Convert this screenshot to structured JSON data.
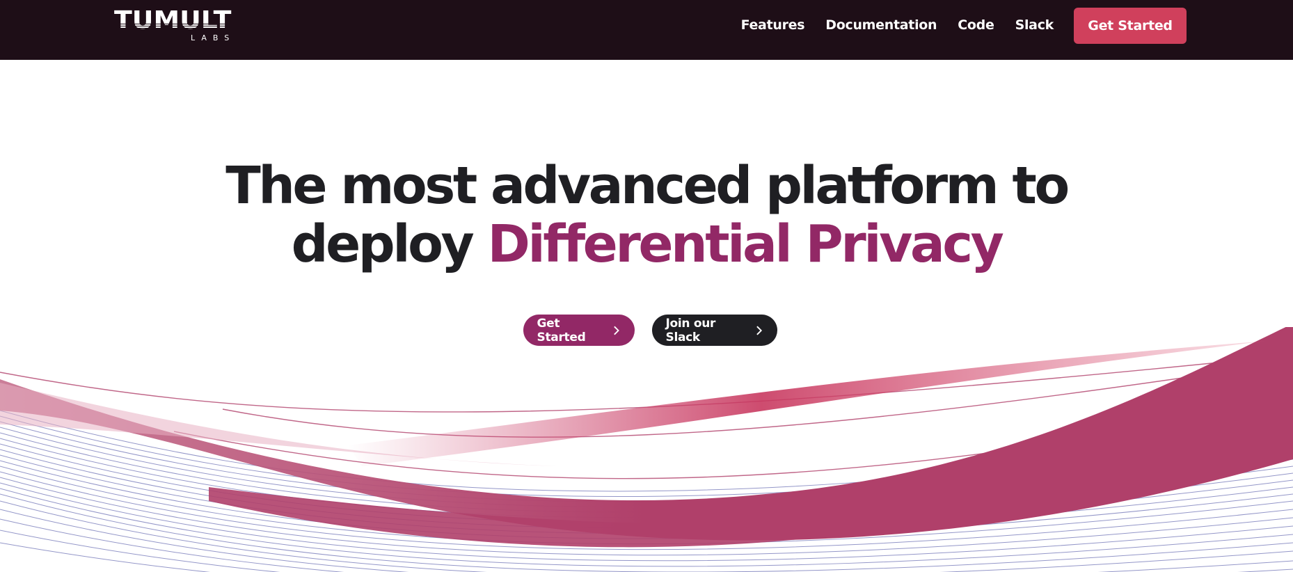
{
  "nav": {
    "logo_main": "TUMULT",
    "logo_sub": "LABS",
    "links": [
      {
        "label": "Features"
      },
      {
        "label": "Documentation"
      },
      {
        "label": "Code"
      },
      {
        "label": "Slack"
      }
    ],
    "cta_label": "Get Started"
  },
  "hero": {
    "title_line1": "The most advanced platform to",
    "title_line2_prefix": "deploy ",
    "title_line2_accent": "Differential Privacy",
    "buttons": {
      "primary_label": "Get Started",
      "secondary_label": "Join our Slack"
    }
  },
  "colors": {
    "nav_bg": "#1e0e17",
    "nav_cta": "#d0405c",
    "accent": "#922866",
    "dark": "#1f1f23",
    "wave_pink": "#b0406a",
    "wave_lines": "#3a3f9a"
  },
  "icons": {
    "chevron": "chevron-right-icon"
  }
}
